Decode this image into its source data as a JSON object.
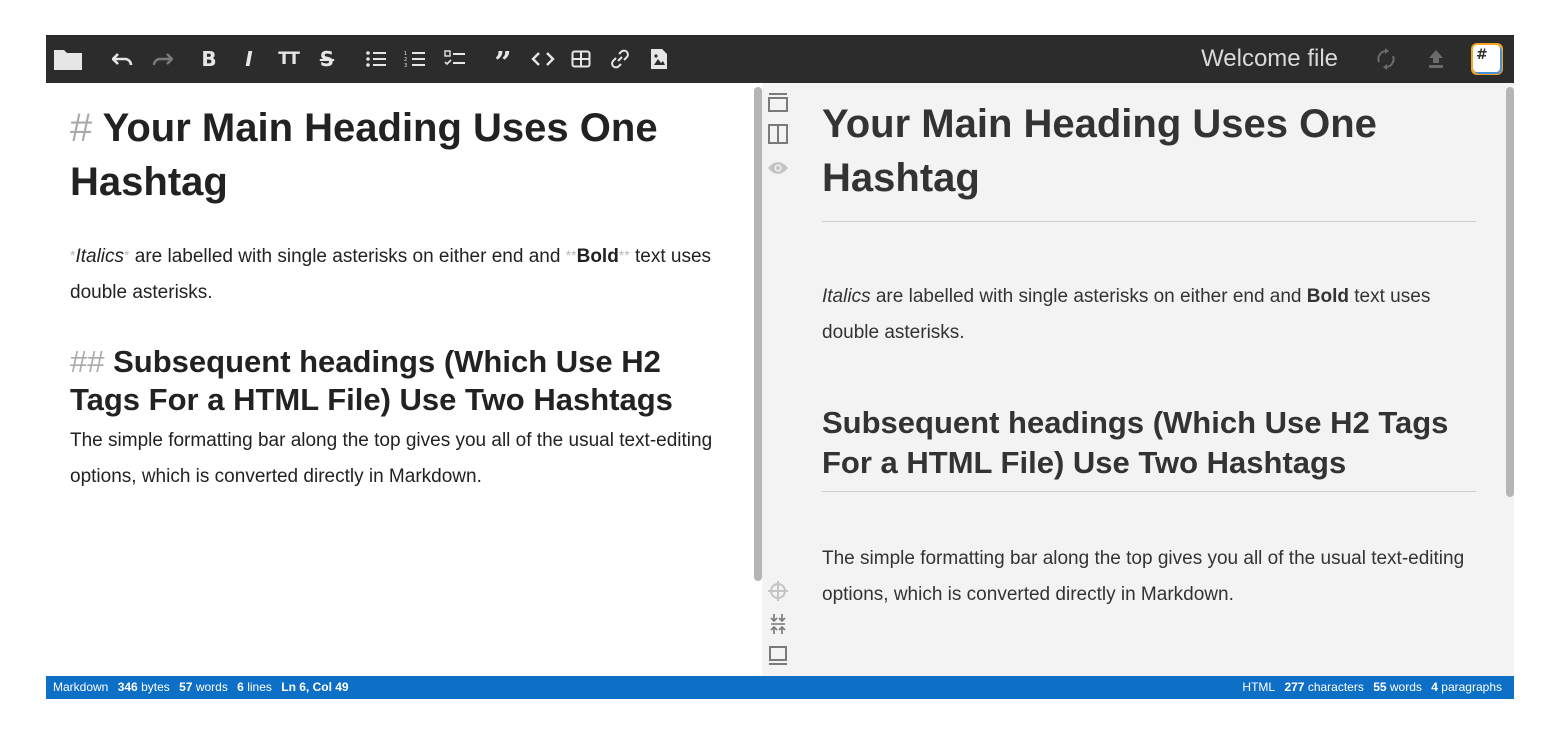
{
  "app": {
    "title": "Welcome file"
  },
  "toolbar": {
    "bold_label": "B",
    "italic_label": "I",
    "heading_label": "TT",
    "strike_label": "S",
    "quote_label": "”"
  },
  "editor": {
    "h1_mark": "#",
    "h1_text": "Your Main Heading Uses One Hashtag",
    "p1_italic_mark": "*",
    "p1_italic": "Italics",
    "p1_mid": " are labelled with single asterisks on either end and ",
    "p1_bold_mark": "**",
    "p1_bold": "Bold",
    "p1_end": " text uses double asterisks.",
    "h2_mark": "##",
    "h2_text": "Subsequent headings (Which Use H2 Tags For a HTML File) Use Two Hashtags",
    "p2": "The simple formatting bar along the top gives you all of the usual text-editing options, which is converted directly in Markdown."
  },
  "preview": {
    "h1": "Your Main Heading Uses One Hashtag",
    "p1_italic": "Italics",
    "p1_mid": " are labelled with single asterisks on either end and ",
    "p1_bold": "Bold",
    "p1_end": " text uses double asterisks.",
    "h2": "Subsequent headings (Which Use H2 Tags For a HTML File) Use Two Hashtags",
    "p2": "The simple formatting bar along the top gives you all of the usual text-editing options, which is converted directly in Markdown."
  },
  "status_left": {
    "mode": "Markdown",
    "bytes": "346",
    "bytes_label": "bytes",
    "words": "57",
    "words_label": "words",
    "lines": "6",
    "lines_label": "lines",
    "cursor": "Ln 6, Col 49"
  },
  "status_right": {
    "mode": "HTML",
    "chars": "277",
    "chars_label": "characters",
    "words": "55",
    "words_label": "words",
    "paragraphs": "4",
    "paragraphs_label": "paragraphs"
  },
  "colors": {
    "toolbar_bg": "#2c2c2c",
    "statusbar_bg": "#0e6fc7",
    "preview_bg": "#f3f3f3",
    "markdown_mark": "#aaaaaa"
  },
  "icons": [
    "folder-icon",
    "undo-icon",
    "redo-icon",
    "bold-icon",
    "italic-icon",
    "heading-icon",
    "strikethrough-icon",
    "unordered-list-icon",
    "ordered-list-icon",
    "check-list-icon",
    "quote-icon",
    "code-icon",
    "table-icon",
    "link-icon",
    "image-icon",
    "sync-icon",
    "publish-icon",
    "stackedit-logo-icon",
    "toggle-navbar-icon",
    "toggle-sidepreview-icon",
    "preview-eye-icon",
    "scroll-sync-icon",
    "toggle-toc-icon",
    "toggle-statusbar-icon"
  ]
}
